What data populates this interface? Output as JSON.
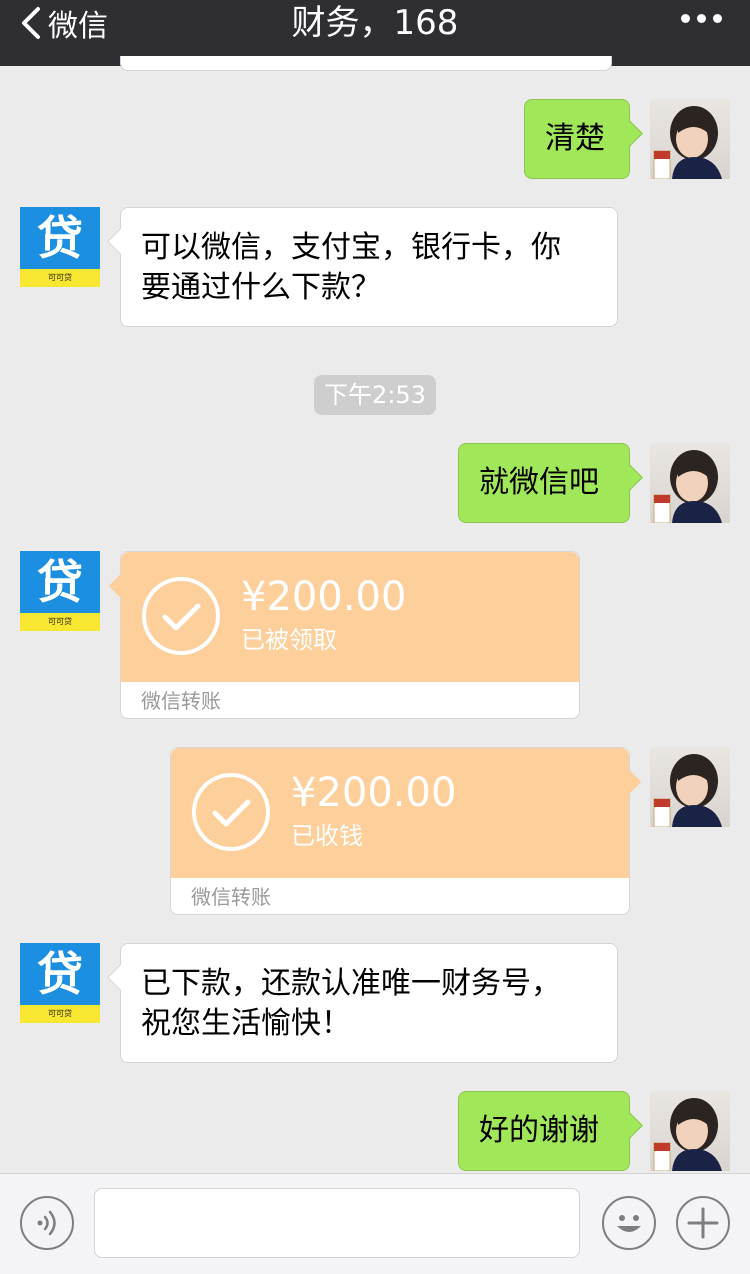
{
  "header": {
    "back_label": "微信",
    "title": "财务，168",
    "more_icon": "ellipsis-icon"
  },
  "timestamp": "下午2:53",
  "avatars": {
    "contact": {
      "glyph": "贷",
      "caption": "可可贷",
      "colors": {
        "blue": "#1d8fe1",
        "yellow": "#f7e731"
      }
    },
    "self": {
      "icon": "profile-photo"
    }
  },
  "messages": [
    {
      "side": "right",
      "text": "清楚"
    },
    {
      "side": "left",
      "text_line1": "可以微信，支付宝，银行卡，你",
      "text_line2": "要通过什么下款？"
    },
    {
      "side": "right",
      "text": "就微信吧"
    },
    {
      "side": "left",
      "type": "transfer",
      "amount": "¥200.00",
      "status": "已被领取",
      "label": "微信转账"
    },
    {
      "side": "right",
      "type": "transfer",
      "amount": "¥200.00",
      "status": "已收钱",
      "label": "微信转账"
    },
    {
      "side": "left",
      "text_line1": "已下款，还款认准唯一财务号，",
      "text_line2": "祝您生活愉快！"
    },
    {
      "side": "right",
      "text": "好的谢谢"
    }
  ],
  "input_bar": {
    "voice_icon": "voice-icon",
    "emoji_icon": "emoji-icon",
    "plus_icon": "plus-icon",
    "input_value": ""
  },
  "colors": {
    "header_bg": "#2e2e33",
    "chat_bg": "#ebebeb",
    "bubble_self": "#a0e75a",
    "bubble_other": "#ffffff",
    "transfer_bg": "#fdcf9b"
  }
}
